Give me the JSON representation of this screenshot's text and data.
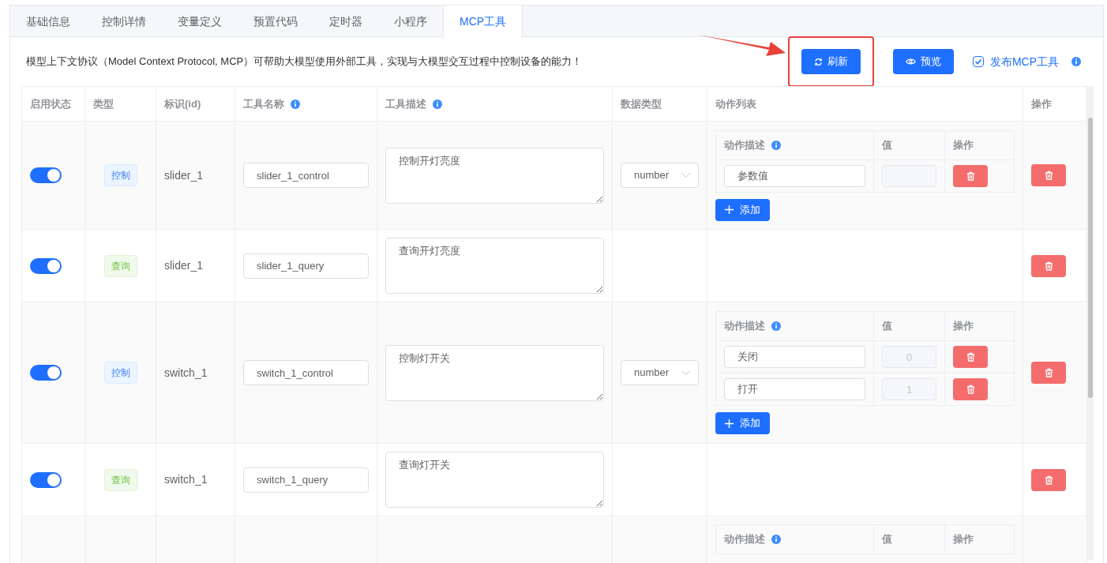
{
  "tabs": [
    {
      "label": "基础信息",
      "selected": false
    },
    {
      "label": "控制详情",
      "selected": false
    },
    {
      "label": "变量定义",
      "selected": false
    },
    {
      "label": "预置代码",
      "selected": false
    },
    {
      "label": "定时器",
      "selected": false
    },
    {
      "label": "小程序",
      "selected": false
    },
    {
      "label": "MCP工具",
      "selected": true
    }
  ],
  "description": "模型上下文协议（Model Context Protocol, MCP）可帮助大模型使用外部工具，实现与大模型交互过程中控制设备的能力！",
  "buttons": [
    {
      "kind": "refresh",
      "label": "刷新",
      "highlighted": true
    },
    {
      "kind": "preview",
      "label": "预览",
      "highlighted": false
    }
  ],
  "publish": {
    "label": "发布MCP工具",
    "checked": true
  },
  "table": {
    "columns": [
      {
        "label": "启用状态",
        "info": false
      },
      {
        "label": "类型",
        "info": false
      },
      {
        "label": "标识(id)",
        "info": false
      },
      {
        "label": "工具名称",
        "info": true
      },
      {
        "label": "工具描述",
        "info": true
      },
      {
        "label": "数据类型",
        "info": false
      },
      {
        "label": "动作列表",
        "info": false
      },
      {
        "label": "操作",
        "info": false
      }
    ],
    "rows": [
      {
        "enabled": true,
        "type": {
          "kind": "control",
          "label": "控制"
        },
        "id": "slider_1",
        "tool_name": "slider_1_control",
        "tool_description": "控制开灯亮度",
        "data_type": "number",
        "action_columns": [
          "动作描述",
          "值",
          "操作"
        ],
        "actions": [
          {
            "description": "参数值",
            "value_disabled": true
          }
        ],
        "add_label": "添加"
      },
      {
        "enabled": true,
        "type": {
          "kind": "query",
          "label": "查询"
        },
        "id": "slider_1",
        "tool_name": "slider_1_query",
        "tool_description": "查询开灯亮度"
      },
      {
        "enabled": true,
        "type": {
          "kind": "control",
          "label": "控制"
        },
        "id": "switch_1",
        "tool_name": "switch_1_control",
        "tool_description": "控制灯开关",
        "data_type": "number",
        "action_columns": [
          "动作描述",
          "值",
          "操作"
        ],
        "actions": [
          {
            "description": "关闭",
            "value": "0",
            "value_disabled": true
          },
          {
            "description": "打开",
            "value": "1",
            "value_disabled": true
          }
        ],
        "add_label": "添加"
      },
      {
        "enabled": true,
        "type": {
          "kind": "query",
          "label": "查询"
        },
        "id": "switch_1",
        "tool_name": "switch_1_query",
        "tool_description": "查询灯开关"
      },
      {
        "action_columns": [
          "动作描述",
          "值",
          "操作"
        ]
      }
    ]
  }
}
